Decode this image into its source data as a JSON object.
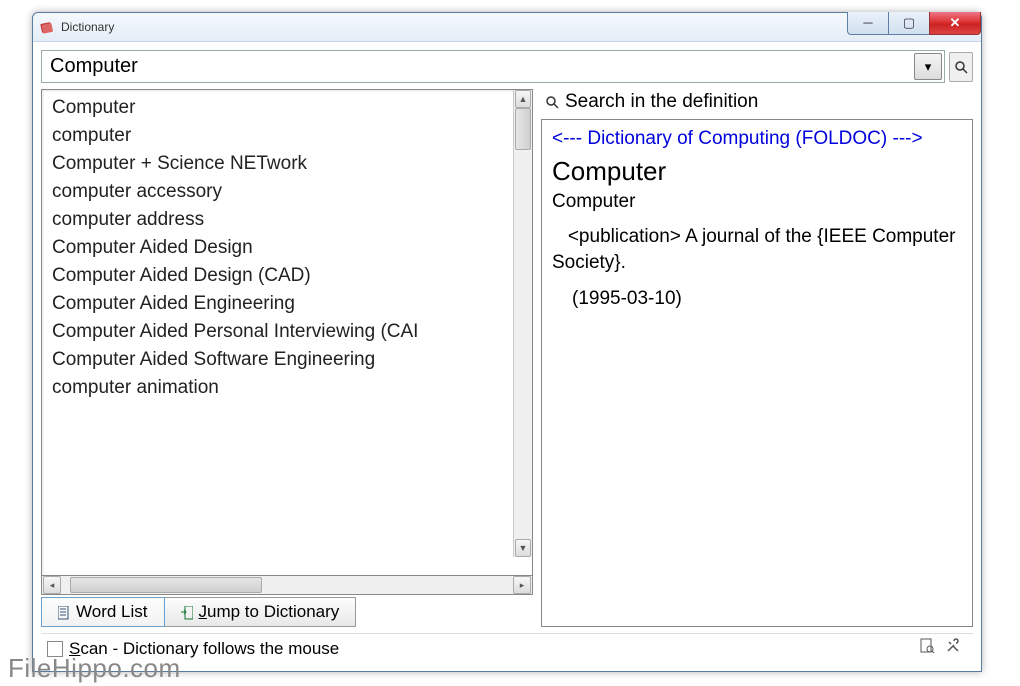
{
  "window": {
    "title": "Dictionary"
  },
  "search": {
    "value": "Computer"
  },
  "wordlist": {
    "items": [
      "Computer",
      "computer",
      "Computer + Science NETwork",
      "computer accessory",
      "computer address",
      "Computer Aided Design",
      "Computer Aided Design (CAD)",
      "Computer Aided Engineering",
      "Computer Aided Personal Interviewing (CAI",
      "Computer Aided Software Engineering",
      "computer animation"
    ]
  },
  "tabs": {
    "wordlist": "Word List",
    "jump": "Jump to Dictionary"
  },
  "rightpane": {
    "searchdef": "Search in the definition",
    "source": "<--- Dictionary of Computing (FOLDOC) --->",
    "headword": "Computer",
    "subword": "Computer",
    "indent": "   <publication>",
    "body_rest": " A journal of the {IEEE Computer Society}.",
    "date": "(1995-03-10)"
  },
  "status": {
    "scan": "Scan - Dictionary follows the mouse"
  },
  "watermark": "FileHippo.com"
}
